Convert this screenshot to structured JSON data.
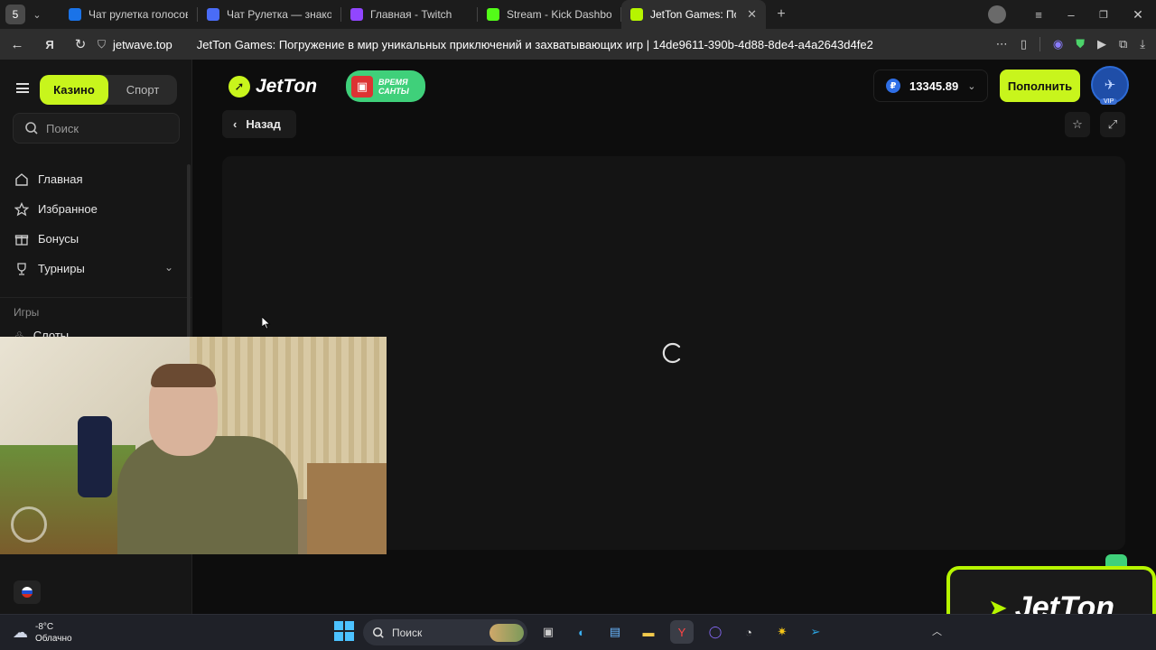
{
  "browser": {
    "profile_badge": "5",
    "tabs": [
      {
        "title": "Чат рулетка голосовая —",
        "color": "#1a73e8"
      },
      {
        "title": "Чат Рулетка — знакомств",
        "color": "#4a6cf7"
      },
      {
        "title": "Главная - Twitch",
        "color": "#9146ff"
      },
      {
        "title": "Stream - Kick Dashboard",
        "color": "#53fc18"
      },
      {
        "title": "JetTon Games: Погруже",
        "color": "#b6f500"
      }
    ],
    "url_domain": "jetwave.top",
    "page_title": "JetTon Games: Погружение в мир уникальных приключений и захватывающих игр | 14de9611-390b-4d88-8de4-a4a2643d4fe2"
  },
  "site": {
    "tabs": {
      "casino": "Казино",
      "sport": "Спорт"
    },
    "search_placeholder": "Поиск",
    "nav": [
      {
        "label": "Главная",
        "icon": "home-icon"
      },
      {
        "label": "Избранное",
        "icon": "star-icon"
      },
      {
        "label": "Бонусы",
        "icon": "gift-icon"
      },
      {
        "label": "Турниры",
        "icon": "trophy-icon"
      }
    ],
    "section_games": "Игры",
    "nav_slots": "Слоты",
    "logo_text": "JetTon",
    "promo_text": "ВРЕМЯ САНТЫ",
    "currency_symbol": "₽",
    "balance": "13345.89",
    "deposit_label": "Пополнить",
    "vip_label": "VIP",
    "back_label": "Назад",
    "accent": "#c8f51c"
  },
  "overlay": {
    "brand": "JetTon"
  },
  "taskbar": {
    "temperature": "-8°C",
    "weather": "Облачно",
    "search_placeholder": "Поиск"
  }
}
